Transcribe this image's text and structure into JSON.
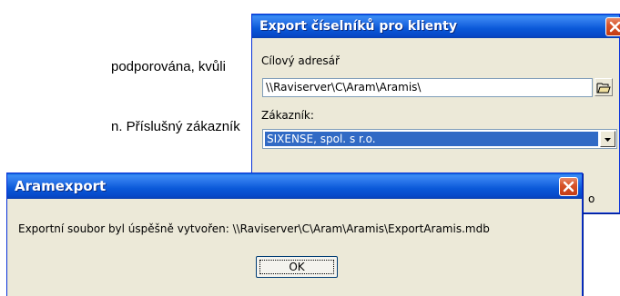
{
  "document": {
    "line1": "podporována, kvůli",
    "line2": "n. Příslušný zákazník"
  },
  "export_dialog": {
    "title": "Export číselníků pro klienty",
    "target_dir_label": "Cílový adresář",
    "target_dir_value": "\\\\Raviserver\\C\\Aram\\Aramis\\",
    "customer_label": "Zákazník:",
    "customer_value": "SIXENSE, spol. s r.o.",
    "hidden_button_fragment": "o"
  },
  "message_box": {
    "title": "Aramexport",
    "message": "Exportní soubor byl úspěšně vytvořen: \\\\Raviserver\\C\\Aram\\Aramis\\ExportAramis.mdb",
    "ok_label": "OK"
  },
  "colors": {
    "titlebar_blue": "#0a58d8",
    "selection_blue": "#316ac5",
    "close_red": "#c43c14",
    "dialog_bg": "#ece9d8"
  }
}
